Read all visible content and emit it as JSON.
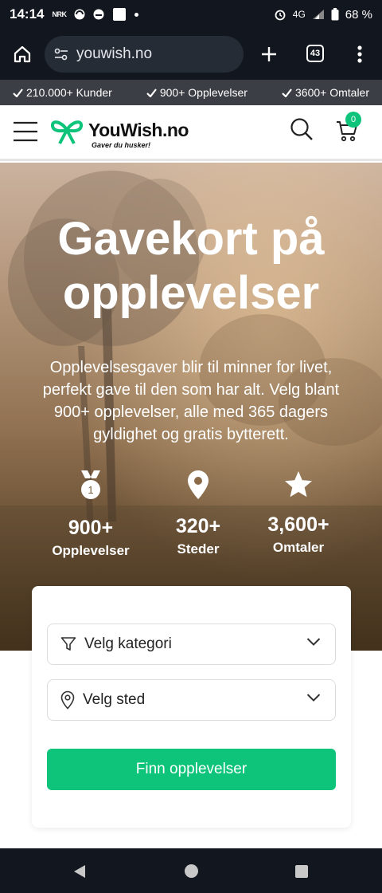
{
  "status_bar": {
    "time": "14:14",
    "network": "4G",
    "battery": "68 %"
  },
  "browser": {
    "url": "youwish.no",
    "tab_count": "43"
  },
  "trust_bar": {
    "items": [
      "210.000+ Kunder",
      "900+ Opplevelser",
      "3600+ Omtaler"
    ]
  },
  "header": {
    "logo_name": "YouWish.no",
    "logo_tagline": "Gaver du husker!",
    "cart_count": "0",
    "brand_color": "#0ec37a"
  },
  "hero": {
    "title_line1": "Gavekort på",
    "title_line2": "opplevelser",
    "subtitle": "Opplevelsesgaver blir til minner for livet, perfekt gave til den som har alt. Velg blant 900+ opplevelser, alle med 365 dagers gyldighet og gratis bytterett.",
    "stats": [
      {
        "icon": "medal-icon",
        "number": "900+",
        "label": "Opplevelser"
      },
      {
        "icon": "location-pin-icon",
        "number": "320+",
        "label": "Steder"
      },
      {
        "icon": "star-icon",
        "number": "3,600+",
        "label": "Omtaler"
      }
    ]
  },
  "search": {
    "category_placeholder": "Velg kategori",
    "location_placeholder": "Velg sted",
    "button_label": "Finn opplevelser"
  }
}
